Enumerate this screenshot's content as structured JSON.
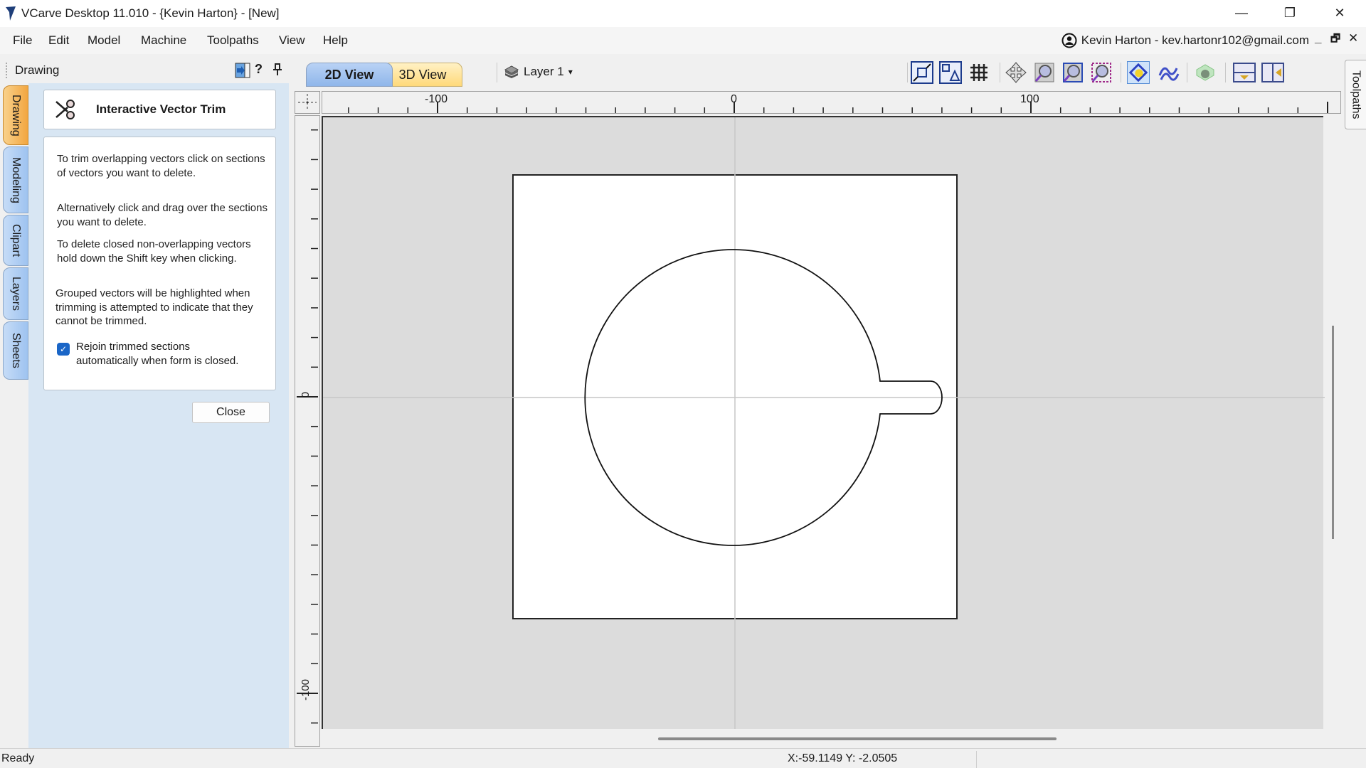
{
  "window": {
    "title": "VCarve Desktop 11.010 - {Kevin Harton} - [New]",
    "controls": {
      "minimize": "—",
      "restore": "❐",
      "close": "✕"
    }
  },
  "menu": [
    "File",
    "Edit",
    "Model",
    "Machine",
    "Toolpaths",
    "View",
    "Help"
  ],
  "account": {
    "label": "Kevin Harton - kev.hartonr102@gmail.com",
    "icon": "user-circle-icon",
    "mdi_controls": {
      "minimize": "_",
      "restore": "🗗",
      "close": "✕"
    }
  },
  "left_panel": {
    "title": "Drawing",
    "header_icons": [
      "dock-icon",
      "help-icon",
      "pin-icon"
    ],
    "help_label": "?",
    "vertical_tabs": [
      {
        "label": "Drawing",
        "active": true
      },
      {
        "label": "Modeling",
        "active": false
      },
      {
        "label": "Clipart",
        "active": false
      },
      {
        "label": "Layers",
        "active": false
      },
      {
        "label": "Sheets",
        "active": false
      }
    ],
    "tool": {
      "icon": "scissors-icon",
      "title": "Interactive Vector Trim",
      "paragraphs": [
        "To trim overlapping vectors click on sections of vectors you want to delete.",
        "Alternatively click and drag over the sections you want to delete.",
        "To delete closed non-overlapping vectors hold down the Shift key when clicking.",
        "Grouped vectors will be highlighted when trimming is attempted to indicate that they cannot be trimmed."
      ],
      "rejoin_checkbox": {
        "label": "Rejoin trimmed sections automatically when form is closed.",
        "checked": true
      },
      "close_label": "Close"
    }
  },
  "view_tabs": [
    {
      "label": "2D View",
      "active": true
    },
    {
      "label": "3D View",
      "active": false
    }
  ],
  "layer": {
    "label": "Layer 1",
    "icon": "layers-icon",
    "caret": "▾"
  },
  "toolbar_icons": [
    "set-job-size-icon",
    "snap-options-icon",
    "grid-icon",
    "pan-icon",
    "zoom-extents-icon",
    "zoom-box-icon",
    "zoom-selection-icon",
    "show-vectors-icon",
    "show-toolpaths-icon",
    "show-model-icon",
    "split-horizontal-icon",
    "split-vertical-icon"
  ],
  "rulers": {
    "horizontal_labels": [
      "-100",
      "0",
      "100"
    ],
    "vertical_labels": [
      "0",
      "-100"
    ]
  },
  "right_tab": {
    "label": "Toolpaths"
  },
  "status": {
    "text": "Ready",
    "coordinates": "X:-59.1149 Y: -2.0505"
  },
  "colors": {
    "active_tab": "#f2a640",
    "inactive_tab": "#9ec3f0",
    "panel_bg": "#d8e6f3",
    "checkbox": "#1a66c7",
    "canvas_bg": "#dcdcdc"
  }
}
